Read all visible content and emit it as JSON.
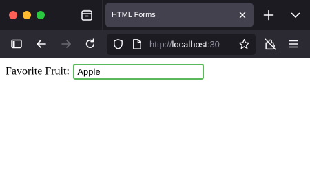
{
  "browser": {
    "tab": {
      "title": "HTML Forms"
    },
    "urlbar": {
      "scheme": "http://",
      "host": "localhost",
      "port_partial": ":30"
    },
    "icons": {
      "tab_overview": "firefox-view-icon",
      "tab_close": "close-icon",
      "new_tab": "plus-icon",
      "tab_list": "chevron-down-icon",
      "sidebar": "sidebar-icon",
      "back": "back-arrow-icon",
      "forward": "forward-arrow-icon",
      "reload": "reload-icon",
      "shield": "shield-icon",
      "page": "page-icon",
      "bookmark": "star-icon",
      "extensions": "extensions-icon",
      "menu": "hamburger-menu-icon"
    },
    "colors": {
      "tabstrip_bg": "#1c1b22",
      "toolbar_bg": "#2b2a33",
      "active_tab_bg": "#42414d",
      "input_focus_border": "#5cb85c"
    }
  },
  "page": {
    "form": {
      "label": "Favorite Fruit:",
      "value": "Apple"
    }
  }
}
